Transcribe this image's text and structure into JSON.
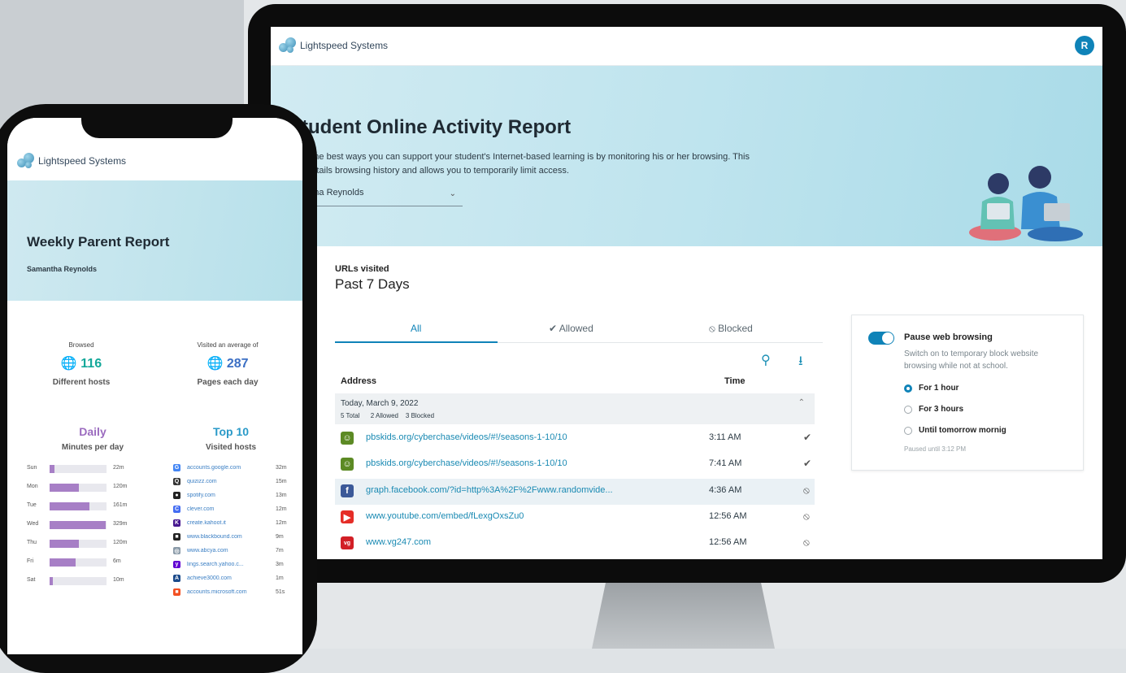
{
  "brand": {
    "name": "Lightspeed Systems"
  },
  "desktop": {
    "user_initial": "R",
    "title": "tudent Online Activity Report",
    "intro_line1": "of the best ways you can support your student's Internet-based learning is by monitoring his or her browsing. This",
    "intro_line2": "t details browsing history and allows you to temporarily limit access.",
    "student_selector": "antha Reynolds",
    "section_label": "URLs visited",
    "section_title": "Past 7 Days",
    "tabs": [
      {
        "label": "All"
      },
      {
        "label": "✔ Allowed"
      },
      {
        "label": "⦸ Blocked"
      }
    ],
    "columns": {
      "address": "Address",
      "time": "Time"
    },
    "group": {
      "date": "Today, March 9, 2022",
      "summary": "5 Total      2 Allowed    3 Blocked"
    },
    "rows": [
      {
        "url": "pbskids.org/cyberchase/videos/#!/seasons-1-10/10",
        "time": "3:11 AM",
        "status": "✔",
        "icon": "pbs-icon",
        "icon_color": "#5c8a24"
      },
      {
        "url": "pbskids.org/cyberchase/videos/#!/seasons-1-10/10",
        "time": "7:41 AM",
        "status": "✔",
        "icon": "pbs-icon",
        "icon_color": "#5c8a24"
      },
      {
        "url": "graph.facebook.com/?id=http%3A%2F%2Fwww.randomvide...",
        "time": "4:36 AM",
        "status": "⦸",
        "icon": "facebook-icon",
        "icon_color": "#3b5998"
      },
      {
        "url": "www.youtube.com/embed/fLexgOxsZu0",
        "time": "12:56 AM",
        "status": "⦸",
        "icon": "youtube-icon",
        "icon_color": "#e52d27"
      },
      {
        "url": "www.vg247.com",
        "time": "12:56 AM",
        "status": "⦸",
        "icon": "vg247-icon",
        "icon_color": "#d21f26"
      }
    ],
    "pause": {
      "title": "Pause web browsing",
      "description": "Switch on to temporary block website browsing while not at school.",
      "options": [
        "For 1 hour",
        "For 3 hours",
        "Until tomorrow mornig"
      ],
      "selected_index": 0,
      "note": "Paused until 3:12 PM",
      "enabled": true
    }
  },
  "phone": {
    "title": "Weekly Parent Report",
    "student": "Samantha Reynolds",
    "browsed": {
      "label": "Browsed",
      "value": "116",
      "sub": "Different hosts"
    },
    "visited": {
      "label": "Visited an average of",
      "value": "287",
      "sub": "Pages each day"
    },
    "daily": {
      "title": "Daily",
      "sub": "Minutes per day"
    },
    "top": {
      "title": "Top 10",
      "sub": "Visited hosts"
    },
    "days": [
      {
        "day": "Sun",
        "value": "22m",
        "pct": 0.09
      },
      {
        "day": "Mon",
        "value": "120m",
        "pct": 0.52
      },
      {
        "day": "Tue",
        "value": "161m",
        "pct": 0.7
      },
      {
        "day": "Wed",
        "value": "329m",
        "pct": 0.98
      },
      {
        "day": "Thu",
        "value": "120m",
        "pct": 0.52
      },
      {
        "day": "Fri",
        "value": "6m",
        "pct": 0.45
      },
      {
        "day": "Sat",
        "value": "10m",
        "pct": 0.05
      }
    ],
    "hosts": [
      {
        "name": "accounts.google.com",
        "value": "32m",
        "icon": "google-icon",
        "color": "#4285f4",
        "glyph": "G"
      },
      {
        "name": "quizizz.com",
        "value": "15m",
        "icon": "quizizz-icon",
        "color": "#333333",
        "glyph": "Q"
      },
      {
        "name": "spotify.com",
        "value": "13m",
        "icon": "spotify-icon",
        "color": "#222222",
        "glyph": "●"
      },
      {
        "name": "clever.com",
        "value": "12m",
        "icon": "clever-icon",
        "color": "#436cf2",
        "glyph": "C"
      },
      {
        "name": "create.kahoot.it",
        "value": "12m",
        "icon": "kahoot-icon",
        "color": "#46178f",
        "glyph": "K"
      },
      {
        "name": "www.blackbound.com",
        "value": "9m",
        "icon": "blackbound-icon",
        "color": "#222222",
        "glyph": "■"
      },
      {
        "name": "www.abcya.com",
        "value": "7m",
        "icon": "abcya-icon",
        "color": "#8a9aa8",
        "glyph": "◎"
      },
      {
        "name": "lings.search.yahoo.c...",
        "value": "3m",
        "icon": "yahoo-icon",
        "color": "#6001d2",
        "glyph": "y"
      },
      {
        "name": "achieve3000.com",
        "value": "1m",
        "icon": "achieve-icon",
        "color": "#1b4a8a",
        "glyph": "A"
      },
      {
        "name": "accounts.microsoft.com",
        "value": "51s",
        "icon": "microsoft-icon",
        "color": "#f25022",
        "glyph": "■"
      }
    ]
  }
}
